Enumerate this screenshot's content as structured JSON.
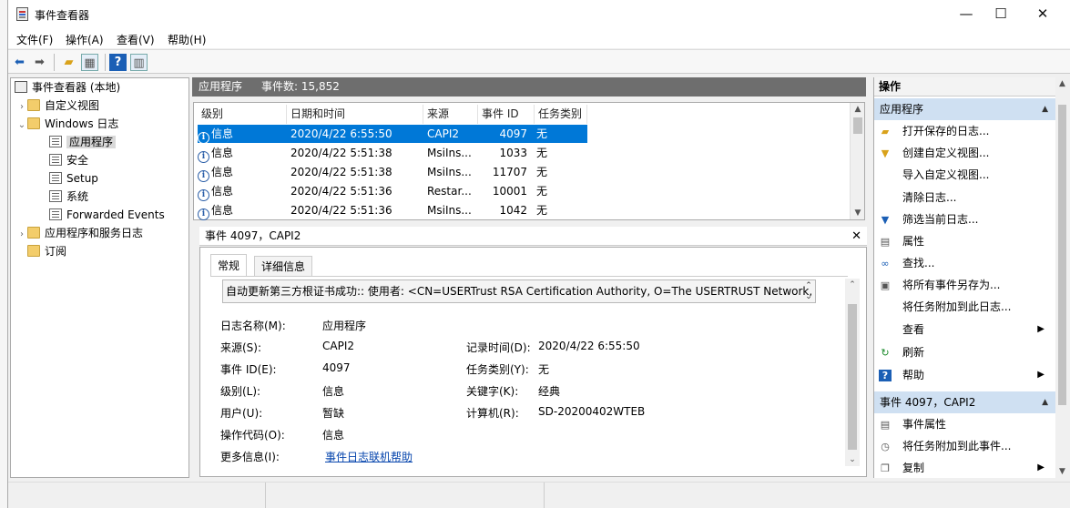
{
  "window": {
    "title": "事件查看器",
    "minimize_glyph": "—",
    "maximize_glyph": "☐",
    "close_glyph": "✕"
  },
  "menu": [
    "文件(F)",
    "操作(A)",
    "查看(V)",
    "帮助(H)"
  ],
  "toolbar": {
    "icons": [
      "back-arrow-icon",
      "forward-arrow-icon",
      "up-folder-icon",
      "show-hide-tree-icon",
      "help-icon",
      "show-hide-action-pane-icon"
    ]
  },
  "tree": {
    "root": "事件查看器 (本地)",
    "custom_views": "自定义视图",
    "windows_logs": "Windows 日志",
    "logs": [
      "应用程序",
      "安全",
      "Setup",
      "系统",
      "Forwarded Events"
    ],
    "app_service_logs": "应用程序和服务日志",
    "subscriptions": "订阅"
  },
  "middle": {
    "header_title": "应用程序",
    "event_count_label": "事件数: 15,852",
    "columns": [
      "级别",
      "日期和时间",
      "来源",
      "事件 ID",
      "任务类别"
    ],
    "rows": [
      {
        "level": "信息",
        "datetime": "2020/4/22 6:55:50",
        "source": "CAPI2",
        "event_id": "4097",
        "task": "无",
        "selected": true
      },
      {
        "level": "信息",
        "datetime": "2020/4/22 5:51:38",
        "source": "MsiIns...",
        "event_id": "1033",
        "task": "无"
      },
      {
        "level": "信息",
        "datetime": "2020/4/22 5:51:38",
        "source": "MsiIns...",
        "event_id": "11707",
        "task": "无"
      },
      {
        "level": "信息",
        "datetime": "2020/4/22 5:51:36",
        "source": "Restar...",
        "event_id": "10001",
        "task": "无"
      },
      {
        "level": "信息",
        "datetime": "2020/4/22 5:51:36",
        "source": "MsiIns...",
        "event_id": "1042",
        "task": "无"
      }
    ]
  },
  "detail": {
    "title": "事件 4097，CAPI2",
    "tabs": [
      "常规",
      "详细信息"
    ],
    "message": "自动更新第三方根证书成功:: 使用者: <CN=USERTrust RSA Certification Authority, O=The USERTRUST Network,",
    "fields_left": [
      {
        "label": "日志名称(M):",
        "value": "应用程序"
      },
      {
        "label": "来源(S):",
        "value": "CAPI2"
      },
      {
        "label": "事件 ID(E):",
        "value": "4097"
      },
      {
        "label": "级别(L):",
        "value": "信息"
      },
      {
        "label": "用户(U):",
        "value": "暂缺"
      },
      {
        "label": "操作代码(O):",
        "value": "信息"
      },
      {
        "label": "更多信息(I):",
        "value": "事件日志联机帮助"
      }
    ],
    "fields_right": [
      {
        "label": "记录时间(D):",
        "value": "2020/4/22 6:55:50"
      },
      {
        "label": "任务类别(Y):",
        "value": "无"
      },
      {
        "label": "关键字(K):",
        "value": "经典"
      },
      {
        "label": "计算机(R):",
        "value": "SD-20200402WTEB"
      }
    ]
  },
  "actions": {
    "title": "操作",
    "section1": "应用程序",
    "section1_items": [
      {
        "label": "打开保存的日志...",
        "icon": "open-folder-icon"
      },
      {
        "label": "创建自定义视图...",
        "icon": "filter-icon"
      },
      {
        "label": "导入自定义视图...",
        "icon": ""
      },
      {
        "label": "清除日志...",
        "icon": ""
      },
      {
        "label": "筛选当前日志...",
        "icon": "filter-icon"
      },
      {
        "label": "属性",
        "icon": "properties-icon"
      },
      {
        "label": "查找...",
        "icon": "binoculars-icon"
      },
      {
        "label": "将所有事件另存为...",
        "icon": "save-icon"
      },
      {
        "label": "将任务附加到此日志...",
        "icon": ""
      },
      {
        "label": "查看",
        "icon": "",
        "submenu": true
      },
      {
        "label": "刷新",
        "icon": "refresh-icon"
      },
      {
        "label": "帮助",
        "icon": "help-icon",
        "submenu": true
      }
    ],
    "section2": "事件 4097，CAPI2",
    "section2_items": [
      {
        "label": "事件属性",
        "icon": "properties-icon"
      },
      {
        "label": "将任务附加到此事件...",
        "icon": "clock-icon"
      },
      {
        "label": "复制",
        "icon": "copy-icon",
        "submenu": true
      }
    ]
  }
}
